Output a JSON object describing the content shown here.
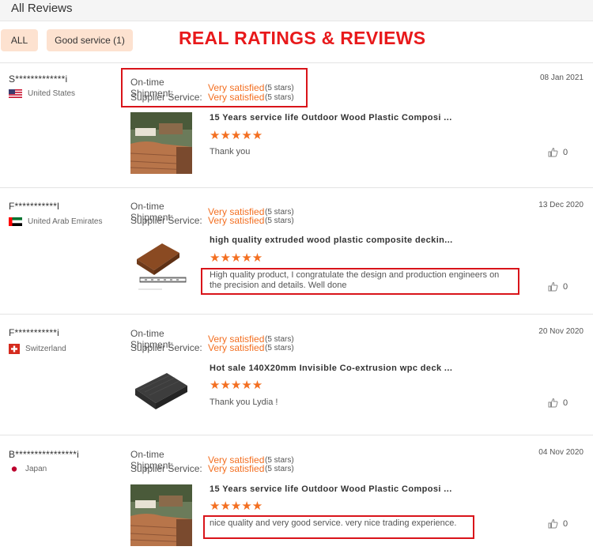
{
  "header": {
    "title": "All Reviews"
  },
  "filters": {
    "all_label": "ALL",
    "good_label": "Good service (1)"
  },
  "banner": "REAL RATINGS & REVIEWS",
  "labels": {
    "shipment": "On-time Shipment:",
    "service": "Supplier Service:",
    "satisfied": "Very satisfied",
    "five_stars": "(5 stars)",
    "stars_glyph": "★★★★★"
  },
  "reviews": [
    {
      "reviewer": "S*************i",
      "country": "United States",
      "date": "08 Jan 2021",
      "product": "15 Years service life Outdoor Wood Plastic Composi ...",
      "comment": "Thank you",
      "likes": "0"
    },
    {
      "reviewer": "F***********l",
      "country": "United Arab Emirates",
      "date": "13 Dec 2020",
      "product": "high quality extruded wood plastic composite deckin...",
      "comment": "High quality product, I congratulate the design and production engineers on the precision and details. Well done",
      "likes": "0"
    },
    {
      "reviewer": "F***********i",
      "country": "Switzerland",
      "date": "20 Nov 2020",
      "product": "Hot sale 140X20mm Invisible Co-extrusion wpc deck ...",
      "comment": "Thank you Lydia !",
      "likes": "0"
    },
    {
      "reviewer": "B****************i",
      "country": "Japan",
      "date": "04 Nov 2020",
      "product": "15 Years service life Outdoor Wood Plastic Composi ...",
      "comment": "nice quality and very good service. very nice trading experience.",
      "likes": "0"
    }
  ]
}
